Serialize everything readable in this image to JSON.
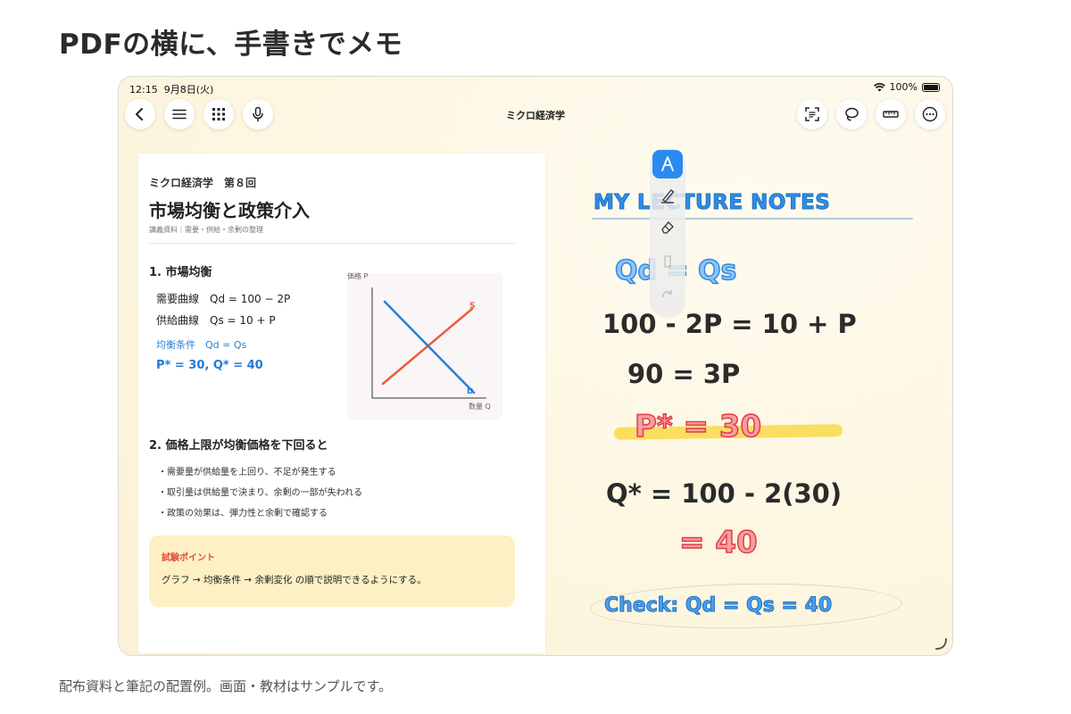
{
  "page": {
    "heading": "PDFの横に、手書きでメモ",
    "caption": "配布資料と筆記の配置例。画面・教材はサンプルです。"
  },
  "status": {
    "time": "12:15",
    "date": "9月8日(火)",
    "battery": "100%"
  },
  "toolbar": {
    "title": "ミクロ経済学",
    "left_icons": [
      "back-icon",
      "menu-icon",
      "grid-icon",
      "microphone-icon"
    ],
    "right_icons": [
      "scan-icon",
      "lasso-icon",
      "ruler-icon",
      "more-icon"
    ]
  },
  "pdf": {
    "subtitle": "ミクロ経済学　第８回",
    "title": "市場均衡と政策介入",
    "meta": "講義資料｜需要・供給・余剰の整理",
    "section1": "1. 市場均衡",
    "demand": "需要曲線　Qd = 100 − 2P",
    "supply": "供給曲線　Qs = 10 + P",
    "condition": "均衡条件　Qd = Qs",
    "result": "P* = 30,  Q* = 40",
    "graph": {
      "ylabel": "価格 P",
      "xlabel": "数量 Q",
      "s_label": "S",
      "d_label": "D",
      "s_color": "#ee5a3c",
      "d_color": "#2a7fd4"
    },
    "section2": "2. 価格上限が均衡価格を下回ると",
    "bullets": [
      "・需要量が供給量を上回り、不足が発生する",
      "・取引量は供給量で決まり、余剰の一部が失われる",
      "・政策の効果は、弾力性と余剰で確認する"
    ],
    "callout_label": "試験ポイント",
    "callout_text": "グラフ → 均衡条件 → 余剰変化 の順で説明できるようにする。"
  },
  "pen_palette": {
    "active_color": "#2a8cf0",
    "tools": [
      "fountain-pen-icon",
      "highlighter-icon",
      "eraser-icon",
      "pencil-icon",
      "redo-icon"
    ]
  },
  "notes": {
    "title": "MY LECTURE NOTES",
    "line1": "Qd = Qs",
    "line2": "100 - 2P = 10 + P",
    "line3": "90 = 3P",
    "line4": "P* = 30",
    "line5": "Q* = 100 - 2(30)",
    "line6": "= 40",
    "line7": "Check: Qd = Qs = 40",
    "colors": {
      "blue": "#2e8ee8",
      "red": "#e13c44",
      "highlight": "#f9d948",
      "ink": "#2b2b2b"
    }
  }
}
